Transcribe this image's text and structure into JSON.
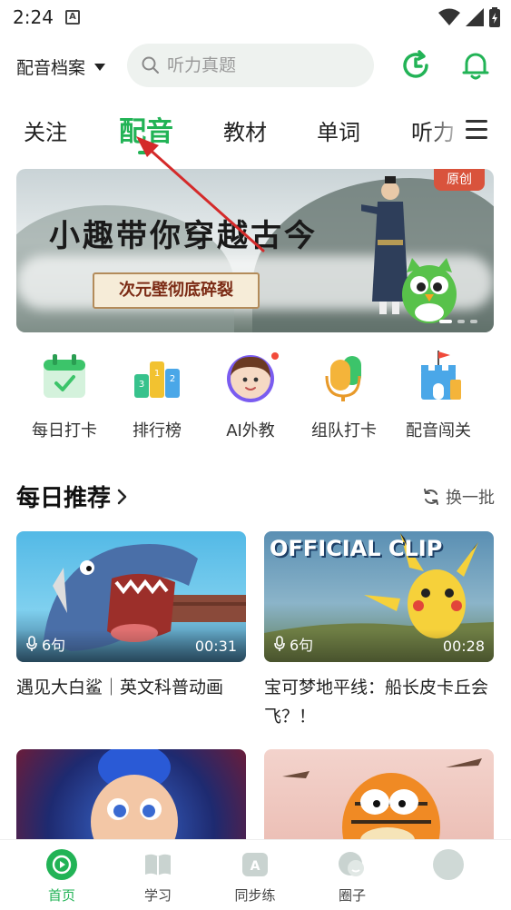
{
  "status_bar": {
    "time": "2:24",
    "badge": "A",
    "icons": [
      "wifi-icon",
      "signal-icon",
      "battery-icon"
    ]
  },
  "header": {
    "profile_label": "配音档案",
    "search_placeholder": "听力真题",
    "icons": [
      "history-icon",
      "bell-icon"
    ]
  },
  "tabs": [
    {
      "label": "关注",
      "active": false
    },
    {
      "label": "配音",
      "active": true
    },
    {
      "label": "教材",
      "active": false
    },
    {
      "label": "单词",
      "active": false
    },
    {
      "label": "听力",
      "active": false
    }
  ],
  "banner": {
    "title": "小趣带你穿越古今",
    "subtitle": "次元壁彻底碎裂",
    "tag": "原创"
  },
  "entries": [
    {
      "label": "每日打卡",
      "icon": "calendar-check-icon"
    },
    {
      "label": "排行榜",
      "icon": "podium-icon"
    },
    {
      "label": "AI外教",
      "icon": "ai-teacher-avatar-icon",
      "dot": true
    },
    {
      "label": "组队打卡",
      "icon": "team-microphone-icon"
    },
    {
      "label": "配音闯关",
      "icon": "castle-flag-icon"
    }
  ],
  "daily": {
    "title": "每日推荐",
    "refresh_label": "换一批",
    "cards": [
      {
        "title": "遇见大白鲨｜英文科普动画",
        "count": "6句",
        "duration": "00:31"
      },
      {
        "title": "宝可梦地平线：船长皮卡丘会飞？！",
        "count": "6句",
        "duration": "00:28",
        "overlay_text": "OFFICIAL CLIP"
      },
      {
        "title": "",
        "count": "",
        "duration": ""
      },
      {
        "title": "",
        "count": "",
        "duration": ""
      }
    ]
  },
  "bottom_nav": [
    {
      "label": "首页",
      "active": true
    },
    {
      "label": "学习",
      "active": false
    },
    {
      "label": "同步练",
      "active": false
    },
    {
      "label": "圈子",
      "active": false
    },
    {
      "label": "",
      "active": false
    }
  ],
  "colors": {
    "accent": "#22b356",
    "banner_tag": "#d9533c",
    "annotation_arrow": "#d42a2a"
  }
}
